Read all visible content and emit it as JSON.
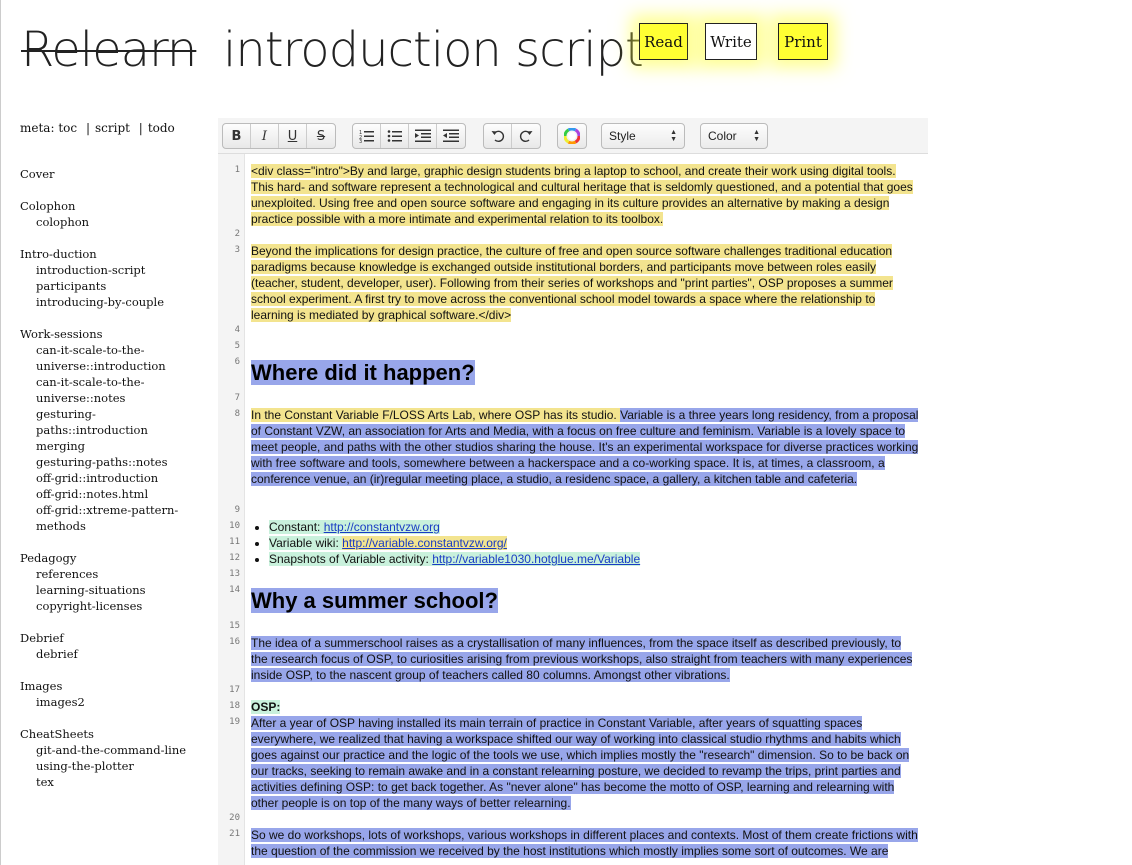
{
  "header": {
    "site_title": "Relearn",
    "page_title": "introduction script",
    "modes": {
      "read": "Read",
      "write": "Write",
      "print": "Print"
    }
  },
  "meta_nav": {
    "meta": "meta:",
    "toc": "toc",
    "sep": "|",
    "script": "script",
    "todo": "todo"
  },
  "toc": [
    {
      "heading": "Cover",
      "items": []
    },
    {
      "heading": "Colophon",
      "items": [
        "colophon"
      ]
    },
    {
      "heading": "Intro-duction",
      "items": [
        "introduction-script",
        "participants",
        "introducing-by-couple"
      ]
    },
    {
      "heading": "Work-sessions",
      "items": [
        "can-it-scale-to-the-",
        "universe::introduction",
        "can-it-scale-to-the-",
        "universe::notes",
        "gesturing-",
        "paths::introduction",
        "merging",
        "gesturing-paths::notes",
        "off-grid::introduction",
        "off-grid::notes.html",
        "off-grid::xtreme-pattern-",
        "methods"
      ]
    },
    {
      "heading": "Pedagogy",
      "items": [
        "references",
        "learning-situations",
        "copyright-licenses"
      ]
    },
    {
      "heading": "Debrief",
      "items": [
        "debrief"
      ]
    },
    {
      "heading": "Images",
      "items": [
        "images2"
      ]
    },
    {
      "heading": "CheatSheets",
      "items": [
        "git-and-the-command-line",
        "using-the-plotter",
        "tex"
      ]
    }
  ],
  "toolbar": {
    "bold": "B",
    "italic": "I",
    "underline": "U",
    "strike": "S",
    "style_label": "Style",
    "color_label": "Color"
  },
  "line_numbers": [
    "1",
    "2",
    "3",
    "4",
    "5",
    "6",
    "7",
    "8",
    "9",
    "10",
    "11",
    "12",
    "13",
    "14",
    "15",
    "16",
    "17",
    "18",
    "19",
    "20",
    "21"
  ],
  "document": {
    "p1": "<div class=\"intro\">By and large, graphic design students bring a laptop to school, and create their work using digital tools. This hard- and software represent a technological and cultural heritage that is seldomly questioned, and a potential that goes unexploited. Using free and open source software and engaging in its culture provides an alternative by making a design practice possible with a more intimate and experimental relation to its toolbox.",
    "p3": "Beyond the implications for design practice, the culture of free and open source software challenges traditional education paradigms because knowledge is exchanged outside institutional borders, and participants move between roles easily (teacher, student, developer, user). Following from their series of workshops and \"print parties\", OSP proposes a summer school experiment. A first try to move across the conventional school model towards a space where the relationship to learning is mediated by graphical software.</div>",
    "h6": "Where did it happen?",
    "p8a": "In the Constant Variable F/LOSS Arts Lab, where OSP has its studio. ",
    "p8b": "Variable is a three years long residency, from a proposal of Constant VZW, an association for Arts and  Media, with a focus on free culture and feminism. Variable is a lovely space to meet people, and paths with the other studios sharing the house.  It's an experimental workspace for diverse practices working with free software and tools, somewhere between a hackerspace and a co-working space. It is, at times, a classroom, a conference venue, an (ir)regular meeting place, a studio, a residenc space, a gallery, a kitchen table and cafeteria.",
    "links": [
      {
        "label": "Constant: ",
        "url": "http://constantvzw.org"
      },
      {
        "label": "Variable wiki: ",
        "url": "http://variable.constantvzw.org/"
      },
      {
        "label": "Snapshots of Variable activity: ",
        "url": "http://variable1030.hotglue.me/Variable"
      }
    ],
    "h14": "Why a summer school?",
    "p16": "The idea of a summerschool raises as a crystallisation of many influences, from the space itself as described previously, to the research focus of OSP, to curiosities arising from previous workshops, also straight from teachers with many experiences inside OSP, to the nascent group of teachers called 80 columns. Amongst other vibrations.",
    "osp_label": "OSP:",
    "p19": "After a year of OSP having installed its main terrain of practice in Constant Variable, after years of squatting spaces everywhere, we realized that having a workspace shifted our way of working into classical studio rhythms and habits which goes against our practice and the logic of the tools we use, which implies mostly the \"research\" dimension. So to be back on our tracks, seeking to remain awake and in a constant relearning posture, we decided to revamp the trips, print parties and activities defining OSP: to get back  together. As \"never alone\" has become the motto of OSP, learning and  relearning with other people is on top of the many ways of better relearning.",
    "p21": "So we do workshops, lots of workshops, various workshops in different places and contexts. Most of them create frictions with the question of the commission we received by the host institutions which mostly implies some sort of outcomes. We are"
  }
}
